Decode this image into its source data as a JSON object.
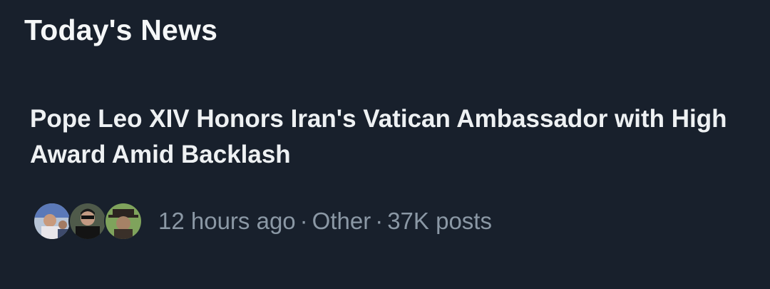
{
  "section": {
    "title": "Today's News"
  },
  "news": {
    "headline": "Pope Leo XIV Honors Iran's Vatican Ambassador with High Award Amid Backlash",
    "time": "12 hours ago",
    "separator": "·",
    "category": "Other",
    "posts": "37K posts",
    "avatars": [
      "avatar-1",
      "avatar-2",
      "avatar-3"
    ]
  },
  "colors": {
    "background": "#18202c",
    "text_primary": "#e7e9ea",
    "text_secondary": "#8b98a5"
  }
}
